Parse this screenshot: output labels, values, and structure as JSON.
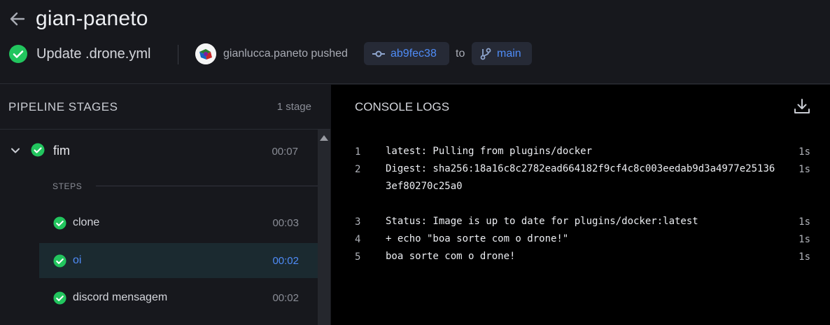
{
  "header": {
    "repo_name": "gian-paneto",
    "commit_message": "Update .drone.yml",
    "pusher_text": "gianlucca.paneto pushed",
    "commit_sha": "ab9fec38",
    "to_text": "to",
    "branch": "main"
  },
  "stages_panel": {
    "title": "PIPELINE STAGES",
    "count": "1 stage",
    "stage": {
      "name": "fim",
      "duration": "00:07"
    },
    "steps_label": "STEPS",
    "steps": [
      {
        "name": "clone",
        "duration": "00:03"
      },
      {
        "name": "oi",
        "duration": "00:02"
      },
      {
        "name": "discord mensagem",
        "duration": "00:02"
      }
    ]
  },
  "console": {
    "title": "CONSOLE LOGS",
    "lines": [
      {
        "no": "1",
        "text": "latest: Pulling from plugins/docker",
        "duration": "1s"
      },
      {
        "no": "2",
        "text": "Digest: sha256:18a16c8c2782ead664182f9cf4c8c003eedab9d3a4977e251363ef80270c25a0",
        "duration": "1s"
      },
      {
        "no": "3",
        "text": "Status: Image is up to date for plugins/docker:latest",
        "duration": "1s"
      },
      {
        "no": "4",
        "text": "+ echo \"boa sorte com o drone!\"",
        "duration": "1s"
      },
      {
        "no": "5",
        "text": "boa sorte com o drone!",
        "duration": "1s"
      }
    ]
  },
  "colors": {
    "success": "#22c55e",
    "accent": "#4f8cf7",
    "console_bg": "#000000",
    "panel_bg": "#17181d"
  }
}
